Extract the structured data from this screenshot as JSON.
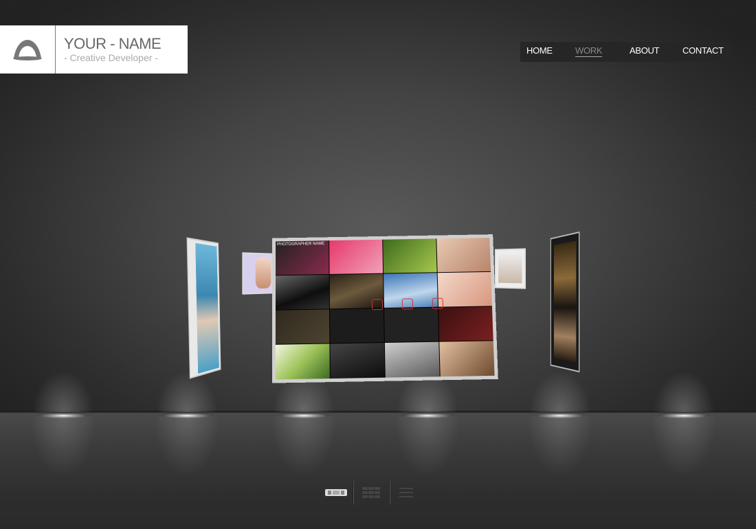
{
  "logo": {
    "name": "YOUR - NAME",
    "tagline": "- Creative Developer -",
    "icon": "eye-logo-icon"
  },
  "nav": {
    "items": [
      {
        "label": "HOME",
        "active": false
      },
      {
        "label": "WORK",
        "active": true
      },
      {
        "label": "ABOUT",
        "active": false
      },
      {
        "label": "CONTACT",
        "active": false
      }
    ]
  },
  "carousel": {
    "main_panel_heading": "PHOTOGRAPHER NAME",
    "colors": {
      "panel_border": "#cfcfcf"
    }
  },
  "view_controls": {
    "modes": [
      {
        "icon": "carousel-view-icon",
        "active": true
      },
      {
        "icon": "grid-view-icon",
        "active": false
      },
      {
        "icon": "list-view-icon",
        "active": false
      }
    ]
  },
  "colors": {
    "background": "#444444",
    "nav_background": "#262626",
    "nav_text": "#ffffff",
    "nav_active_text": "#888888",
    "logo_background": "#ffffff",
    "logo_text": "#666666"
  }
}
